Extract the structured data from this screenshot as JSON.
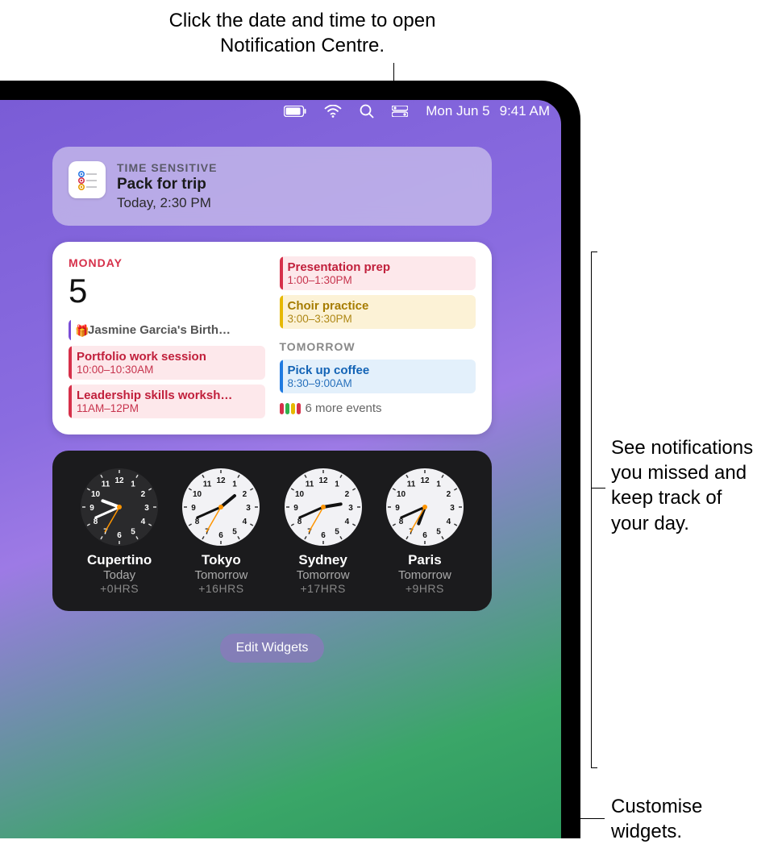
{
  "callouts": {
    "top": "Click the date and time to open Notification Centre.",
    "right_mid": "See notifications you missed and keep track of your day.",
    "right_bot": "Customise widgets."
  },
  "menubar": {
    "date": "Mon Jun 5",
    "time": "9:41 AM"
  },
  "notification": {
    "eyebrow": "TIME SENSITIVE",
    "title": "Pack for trip",
    "subtitle": "Today, 2:30 PM"
  },
  "calendar": {
    "dayname": "MONDAY",
    "daynum": "5",
    "left_events": [
      {
        "kind": "bday",
        "title": "Jasmine Garcia's Birth…"
      },
      {
        "kind": "red",
        "title": "Portfolio work session",
        "time": "10:00–10:30AM"
      },
      {
        "kind": "red",
        "title": "Leadership skills worksh…",
        "time": "11AM–12PM"
      }
    ],
    "right_events": [
      {
        "kind": "red",
        "title": "Presentation prep",
        "time": "1:00–1:30PM"
      },
      {
        "kind": "yellow",
        "title": "Choir practice",
        "time": "3:00–3:30PM"
      }
    ],
    "tomorrow_label": "TOMORROW",
    "tomorrow_event": {
      "kind": "blue",
      "title": "Pick up coffee",
      "time": "8:30–9:00AM"
    },
    "more_label": "6 more events"
  },
  "clocks": [
    {
      "city": "Cupertino",
      "day": "Today",
      "offset": "+0HRS",
      "face": "dark",
      "h": 9,
      "m": 41
    },
    {
      "city": "Tokyo",
      "day": "Tomorrow",
      "offset": "+16HRS",
      "face": "light",
      "h": 1,
      "m": 41
    },
    {
      "city": "Sydney",
      "day": "Tomorrow",
      "offset": "+17HRS",
      "face": "light",
      "h": 2,
      "m": 41
    },
    {
      "city": "Paris",
      "day": "Tomorrow",
      "offset": "+9HRS",
      "face": "light",
      "h": 18,
      "m": 41
    }
  ],
  "edit_button": "Edit Widgets"
}
